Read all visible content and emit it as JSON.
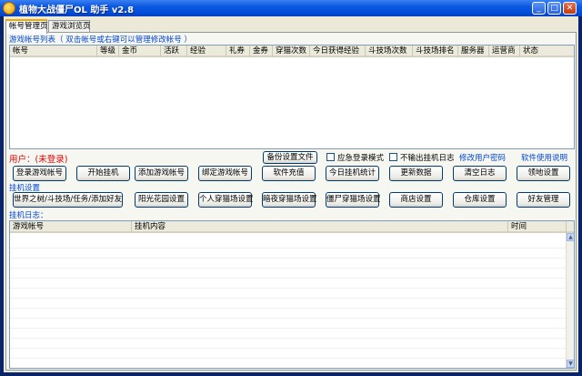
{
  "window": {
    "title": "植物大战僵尸OL 助手  v2.8",
    "minimize_glyph": "_",
    "maximize_glyph": "□",
    "close_glyph": "✕"
  },
  "tabs": [
    {
      "label": "帐号管理页",
      "active": true
    },
    {
      "label": "游戏浏览页",
      "active": false
    }
  ],
  "accounts": {
    "group_label": "游戏帐号列表（ 双击帐号或右键可以管理修改帐号 ）",
    "columns": [
      "帐号",
      "等级",
      "金币",
      "活跃",
      "经验",
      "礼券",
      "金券",
      "穿猫次数",
      "今日获得经验",
      "斗技场次数",
      "斗技场排名",
      "服务器",
      "运营商",
      "状态"
    ]
  },
  "user": {
    "label": "用户：(未登录)"
  },
  "top_controls": {
    "backup_button": "备份设置文件",
    "emergency_login": "应急登录模式",
    "no_log_output": "不输出挂机日志",
    "change_password": "修改用户密码",
    "help": "软件使用说明"
  },
  "row1_buttons": [
    "登录游戏帐号",
    "开始挂机",
    "添加游戏帐号",
    "绑定游戏帐号",
    "软件充值",
    "今日挂机统计",
    "更新数据",
    "清空日志",
    "领地设置"
  ],
  "settings_label": "挂机设置",
  "row2_buttons": [
    "世界之树/斗技场/任务/添加好友",
    "阳光花园设置",
    "个人穿猫场设置",
    "暗夜穿猫场设置",
    "僵尸穿猫场设置",
    "商店设置",
    "仓库设置",
    "好友管理"
  ],
  "log": {
    "group_label": "挂机日志：",
    "columns": [
      "游戏帐号",
      "挂机内容",
      "时间"
    ]
  },
  "colors": {
    "title_blue": "#0450dd",
    "group_label_blue": "#0046d5",
    "user_red": "#e00000",
    "panel_bg": "#f7f7f2"
  }
}
